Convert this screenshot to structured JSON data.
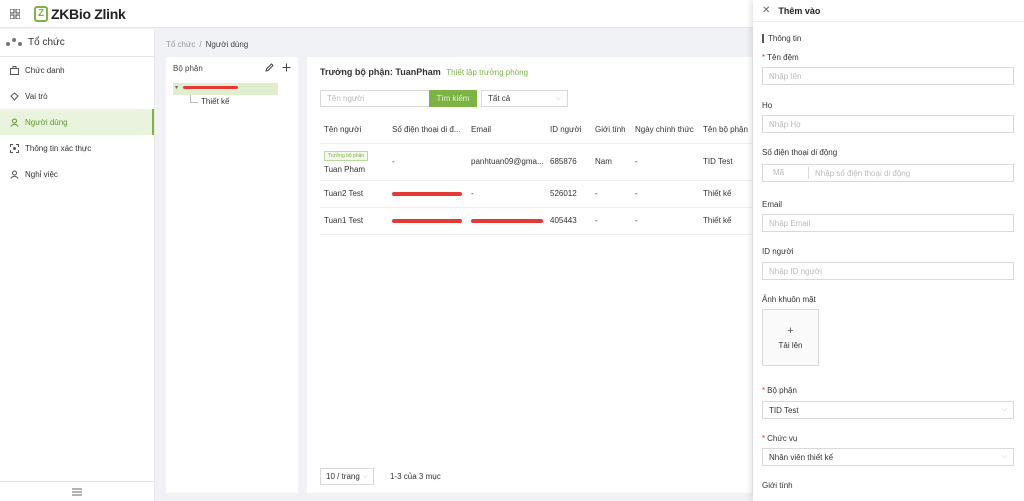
{
  "topbar": {
    "logo_mark": "Z",
    "logo_text": "ZKBio Zlink"
  },
  "sidebar": {
    "header": "Tổ chức",
    "items": [
      {
        "label": "Chức danh",
        "icon": "briefcase-icon"
      },
      {
        "label": "Vai trò",
        "icon": "role-icon"
      },
      {
        "label": "Người dùng",
        "icon": "user-icon",
        "active": true
      },
      {
        "label": "Thông tin xác thực",
        "icon": "scan-icon"
      },
      {
        "label": "Nghỉ việc",
        "icon": "user-leave-icon"
      }
    ]
  },
  "breadcrumb": {
    "parent": "Tổ chức",
    "sep": "/",
    "current": "Người dùng"
  },
  "dept_panel": {
    "title": "Bộ phận",
    "child": "Thiết kế"
  },
  "main": {
    "title": "Trưởng bộ phận: TuanPham",
    "title_link": "Thiết lập trưởng phòng",
    "search_placeholder": "Tên người",
    "search_button": "Tìm kiếm",
    "filter_value": "Tất cả",
    "columns": [
      "Tên người",
      "Số điện thoại di đ...",
      "Email",
      "ID người",
      "Giới tính",
      "Ngày chính thức",
      "Tên bộ phận"
    ],
    "rows": [
      {
        "tag": "Trưởng bộ phận",
        "name": "Tuan Pham",
        "phone": "-",
        "email": "panhtuan09@gma...",
        "id": "685876",
        "gender": "Nam",
        "date": "-",
        "dept": "TID Test"
      },
      {
        "name": "Tuan2 Test",
        "phone": "",
        "email": "-",
        "id": "526012",
        "gender": "-",
        "date": "-",
        "dept": "Thiết kế"
      },
      {
        "name": "Tuan1 Test",
        "phone": "",
        "email": "",
        "id": "405443",
        "gender": "-",
        "date": "-",
        "dept": "Thiết kế"
      }
    ],
    "page_size": "10 / trang",
    "page_info": "1-3 của 3 mục"
  },
  "drawer": {
    "title": "Thêm vào",
    "section": "Thông tin",
    "fields": {
      "middle_name_label": "Tên đệm",
      "middle_name_placeholder": "Nhập tên",
      "last_name_label": "Họ",
      "last_name_placeholder": "Nhập Họ",
      "phone_label": "Số điện thoại di động",
      "phone_prefix": "Mã",
      "phone_placeholder": "Nhập số điện thoại di động",
      "email_label": "Email",
      "email_placeholder": "Nhập Email",
      "id_label": "ID người",
      "id_placeholder": "Nhập ID người",
      "face_label": "Ảnh khuôn mặt",
      "upload_label": "Tải lên",
      "dept_label": "Bộ phận",
      "dept_value": "TID Test",
      "position_label": "Chức vụ",
      "position_value": "Nhân viên thiết kế",
      "gender_label": "Giới tính"
    }
  }
}
